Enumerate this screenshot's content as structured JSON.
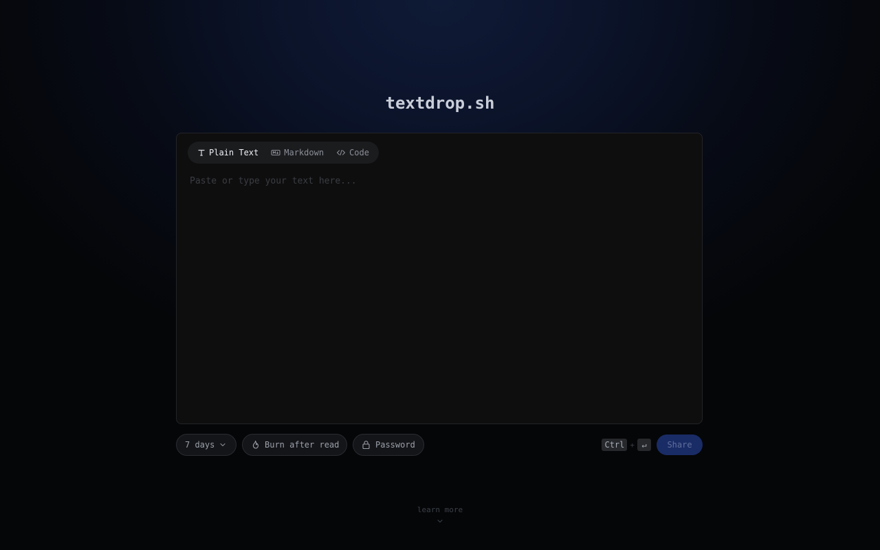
{
  "brand": {
    "title": "textdrop.sh"
  },
  "editor": {
    "tabs": [
      {
        "label": "Plain Text",
        "icon": "text-type-icon",
        "active": true
      },
      {
        "label": "Markdown",
        "icon": "markdown-icon",
        "active": false
      },
      {
        "label": "Code",
        "icon": "code-icon",
        "active": false
      }
    ],
    "placeholder": "Paste or type your text here...",
    "value": ""
  },
  "controls": {
    "expiry": {
      "label": "7 days",
      "icon": "chevron-down-icon"
    },
    "burn": {
      "label": "Burn after read",
      "icon": "flame-icon"
    },
    "password": {
      "label": "Password",
      "icon": "lock-icon"
    },
    "shortcut": {
      "key1": "Ctrl",
      "plus": "+",
      "key2": "↵"
    },
    "share": {
      "label": "Share"
    }
  },
  "footer": {
    "learn_more": "learn more",
    "icon": "chevron-down-icon"
  },
  "colors": {
    "background": "#050608",
    "glow": "#0f1a36",
    "panel": "#0e0e0f",
    "share_button": "#1a2c66"
  }
}
